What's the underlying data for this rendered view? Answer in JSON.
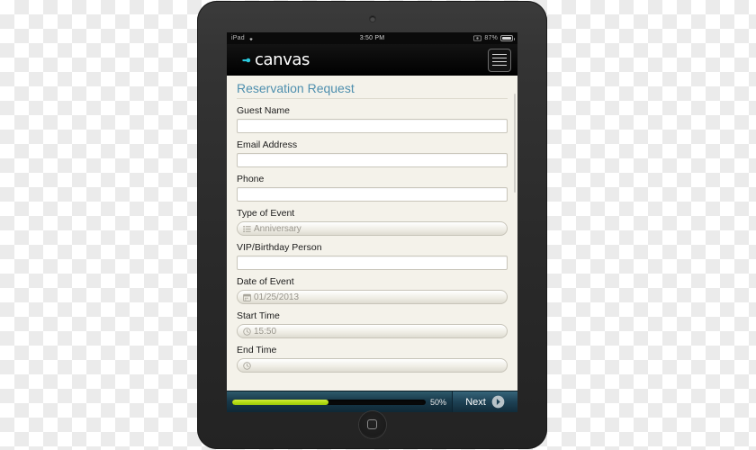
{
  "device": {
    "type": "tablet",
    "camera_name": "front-camera",
    "home_button_name": "home-button"
  },
  "statusbar": {
    "carrier": "iPad",
    "wifi_icon": "wifi-icon",
    "time": "3:50 PM",
    "sync_icon": "sync-icon",
    "battery_percent": "87%",
    "battery_icon": "battery-icon"
  },
  "appbar": {
    "logo_name": "canvas-logo",
    "logo_text": "canvas",
    "logo_color": "#2bc9dd",
    "menu_label": "menu"
  },
  "form": {
    "title": "Reservation Request",
    "title_color": "#4e8fae",
    "fields": [
      {
        "label": "Guest Name",
        "type": "text",
        "value": "",
        "icon": ""
      },
      {
        "label": "Email Address",
        "type": "text",
        "value": "",
        "icon": ""
      },
      {
        "label": "Phone",
        "type": "text",
        "value": "",
        "icon": ""
      },
      {
        "label": "Type of Event",
        "type": "select",
        "value": "Anniversary",
        "icon": "list-icon"
      },
      {
        "label": "VIP/Birthday Person",
        "type": "text",
        "value": "",
        "icon": ""
      },
      {
        "label": "Date of Event",
        "type": "date",
        "value": "01/25/2013",
        "icon": "calendar-icon"
      },
      {
        "label": "Start Time",
        "type": "time",
        "value": "15:50",
        "icon": "clock-icon"
      },
      {
        "label": "End Time",
        "type": "time",
        "value": "",
        "icon": "clock-icon"
      }
    ]
  },
  "bottombar": {
    "progress_percent": 50,
    "progress_label": "50%",
    "progress_color": "#b5dd14",
    "next_label": "Next",
    "next_icon": "arrow-right-circle-icon"
  }
}
